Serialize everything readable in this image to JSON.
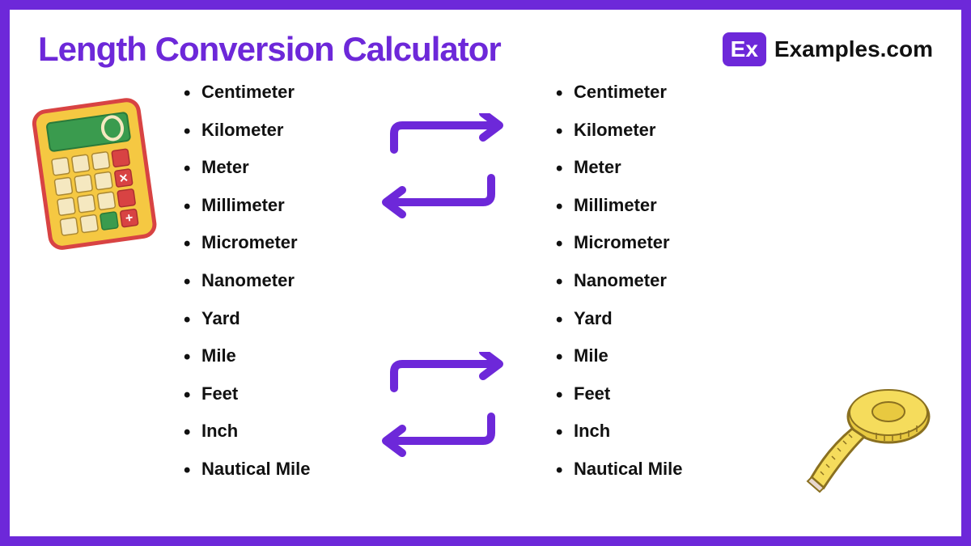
{
  "title": "Length Conversion Calculator",
  "logo": {
    "badge": "Ex",
    "text": "Examples.com"
  },
  "units_left": [
    "Centimeter",
    "Kilometer",
    "Meter",
    "Millimeter",
    "Micrometer",
    "Nanometer",
    "Yard",
    "Mile",
    "Feet",
    "Inch",
    "Nautical Mile"
  ],
  "units_right": [
    "Centimeter",
    "Kilometer",
    "Meter",
    "Millimeter",
    "Micrometer",
    "Nanometer",
    "Yard",
    "Mile",
    "Feet",
    "Inch",
    "Nautical Mile"
  ],
  "colors": {
    "primary": "#6d28d9"
  }
}
